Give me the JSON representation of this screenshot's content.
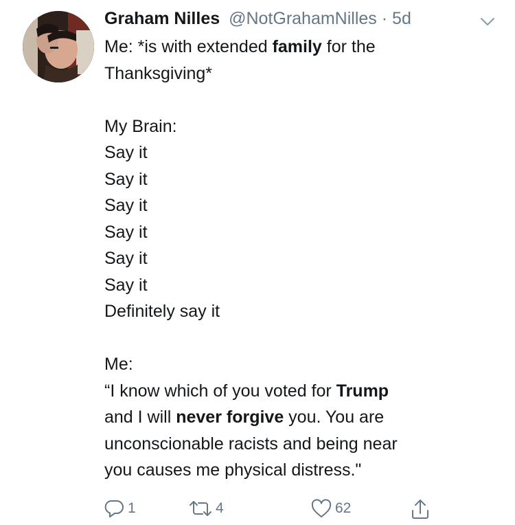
{
  "tweet": {
    "author": {
      "display_name": "Graham Nilles",
      "handle": "@NotGrahamNilles",
      "separator": "·",
      "time": "5d"
    },
    "body_lines": [
      [
        {
          "t": "Me: *is with extended "
        },
        {
          "t": "family",
          "bold": true
        },
        {
          "t": " for the"
        }
      ],
      [
        {
          "t": "Thanksgiving*"
        }
      ],
      [
        {
          "t": ""
        }
      ],
      [
        {
          "t": "My Brain:"
        }
      ],
      [
        {
          "t": "Say it"
        }
      ],
      [
        {
          "t": "Say it"
        }
      ],
      [
        {
          "t": "Say it"
        }
      ],
      [
        {
          "t": "Say it"
        }
      ],
      [
        {
          "t": "Say it"
        }
      ],
      [
        {
          "t": "Say it"
        }
      ],
      [
        {
          "t": "Definitely say it"
        }
      ],
      [
        {
          "t": ""
        }
      ],
      [
        {
          "t": "Me:"
        }
      ],
      [
        {
          "t": "“I know which of you voted for "
        },
        {
          "t": "Trump",
          "bold": true
        }
      ],
      [
        {
          "t": "and I will "
        },
        {
          "t": "never forgive",
          "bold": true
        },
        {
          "t": " you. You are"
        }
      ],
      [
        {
          "t": "unconscionable racists and being near"
        }
      ],
      [
        {
          "t": "you causes me physical distress.\""
        }
      ]
    ],
    "actions": {
      "reply_count": "1",
      "retweet_count": "4",
      "like_count": "62"
    }
  },
  "icons": {
    "reply": "reply-icon",
    "retweet": "retweet-icon",
    "like": "heart-icon",
    "share": "share-icon",
    "menu": "chevron-down-icon"
  },
  "colors": {
    "text": "#14171a",
    "muted": "#657786"
  }
}
